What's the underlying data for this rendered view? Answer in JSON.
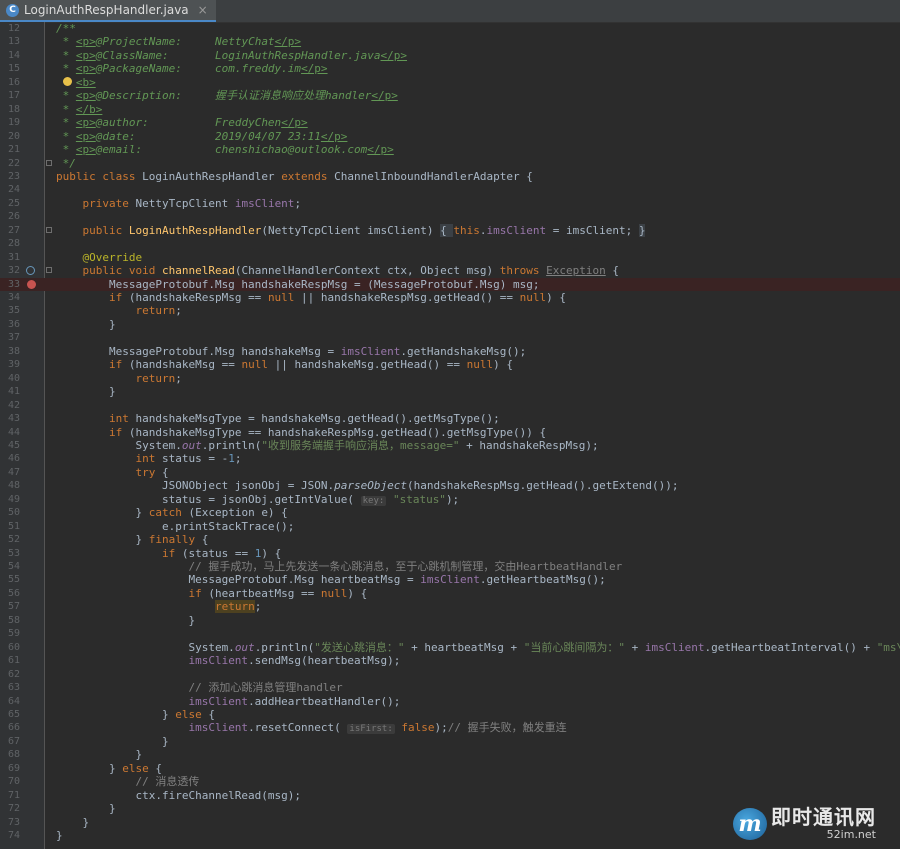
{
  "tab": {
    "filename": "LoginAuthRespHandler.java",
    "icon_letter": "C",
    "close_glyph": "×"
  },
  "lines": [
    {
      "n": "12",
      "html": "<span class=\"cm\">/**</span>"
    },
    {
      "n": "13",
      "html": "<span class=\"cm\"> * <span class=\"tg\">&lt;p&gt;</span>@ProjectName:     NettyChat<span class=\"tg\">&lt;/p&gt;</span></span>"
    },
    {
      "n": "14",
      "html": "<span class=\"cm\"> * <span class=\"tg\">&lt;p&gt;</span>@ClassName:       LoginAuthRespHandler.java<span class=\"tg\">&lt;/p&gt;</span></span>"
    },
    {
      "n": "15",
      "html": "<span class=\"cm\"> * <span class=\"tg\">&lt;p&gt;</span>@PackageName:     com.freddy.im<span class=\"tg\">&lt;/p&gt;</span></span>"
    },
    {
      "n": "16",
      "html": "<span class=\"cm\">   <span class=\"tg\">&lt;b&gt;</span></span>",
      "bulb": true
    },
    {
      "n": "17",
      "html": "<span class=\"cm\"> * <span class=\"tg\">&lt;p&gt;</span>@Description:     握手认证消息响应处理handler<span class=\"tg\">&lt;/p&gt;</span></span>"
    },
    {
      "n": "18",
      "html": "<span class=\"cm\"> * <span class=\"tg\">&lt;/b&gt;</span></span>"
    },
    {
      "n": "19",
      "html": "<span class=\"cm\"> * <span class=\"tg\">&lt;p&gt;</span>@author:          FreddyChen<span class=\"tg\">&lt;/p&gt;</span></span>"
    },
    {
      "n": "20",
      "html": "<span class=\"cm\"> * <span class=\"tg\">&lt;p&gt;</span>@date:            2019/04/07 23:11<span class=\"tg\">&lt;/p&gt;</span></span>"
    },
    {
      "n": "21",
      "html": "<span class=\"cm\"> * <span class=\"tg\">&lt;p&gt;</span>@email:           chenshichao@outlook.com<span class=\"tg\">&lt;/p&gt;</span></span>"
    },
    {
      "n": "22",
      "html": "<span class=\"cm\"> */</span>",
      "fold": true
    },
    {
      "n": "23",
      "html": "<span class=\"kw\">public class</span> LoginAuthRespHandler <span class=\"kw\">extends</span> ChannelInboundHandlerAdapter {"
    },
    {
      "n": "24",
      "html": ""
    },
    {
      "n": "25",
      "html": "    <span class=\"kw\">private</span> NettyTcpClient <span class=\"fld\">imsClient</span>;"
    },
    {
      "n": "26",
      "html": ""
    },
    {
      "n": "27",
      "html": "    <span class=\"kw\">public</span> <span class=\"fn\">LoginAuthRespHandler</span>(NettyTcpClient imsClient) <span class=\"fold-box\">{ </span><span class=\"kw\">this</span>.<span class=\"fld\">imsClient</span> = imsClient; <span class=\"fold-box\">}</span>",
      "fold": true
    },
    {
      "n": "28",
      "html": ""
    },
    {
      "n": "31",
      "html": "    <span class=\"an\">@Override</span>"
    },
    {
      "n": "32",
      "html": "    <span class=\"kw\">public void</span> <span class=\"fn\">channelRead</span>(ChannelHandlerContext ctx, Object msg) <span class=\"kw\">throws</span> <span class=\"lc\" style=\"text-decoration:underline\">Exception</span> {",
      "ovr": true,
      "fold": true
    },
    {
      "n": "33",
      "html": "        MessageProtobuf.Msg handshakeRespMsg = (MessageProtobuf.Msg) msg;",
      "bp": true
    },
    {
      "n": "34",
      "html": "        <span class=\"kw\">if</span> (handshakeRespMsg == <span class=\"kw\">null</span> || handshakeRespMsg.getHead() == <span class=\"kw\">null</span>) {"
    },
    {
      "n": "35",
      "html": "            <span class=\"kw\">return</span>;"
    },
    {
      "n": "36",
      "html": "        }"
    },
    {
      "n": "37",
      "html": ""
    },
    {
      "n": "38",
      "html": "        MessageProtobuf.Msg handshakeMsg = <span class=\"fld\">imsClient</span>.getHandshakeMsg();"
    },
    {
      "n": "39",
      "html": "        <span class=\"kw\">if</span> (handshakeMsg == <span class=\"kw\">null</span> || handshakeMsg.getHead() == <span class=\"kw\">null</span>) {"
    },
    {
      "n": "40",
      "html": "            <span class=\"kw\">return</span>;"
    },
    {
      "n": "41",
      "html": "        }"
    },
    {
      "n": "42",
      "html": ""
    },
    {
      "n": "43",
      "html": "        <span class=\"kw\">int</span> handshakeMsgType = handshakeMsg.getHead().getMsgType();"
    },
    {
      "n": "44",
      "html": "        <span class=\"kw\">if</span> (handshakeMsgType == handshakeRespMsg.getHead().getMsgType()) {"
    },
    {
      "n": "45",
      "html": "            System.<span class=\"fld it\">out</span>.println(<span class=\"st\">\"收到服务端握手响应消息，message=\"</span> + handshakeRespMsg);"
    },
    {
      "n": "46",
      "html": "            <span class=\"kw\">int</span> status = -<span style=\"color:#6897bb\">1</span>;"
    },
    {
      "n": "47",
      "html": "            <span class=\"kw\">try</span> {"
    },
    {
      "n": "48",
      "html": "                JSONObject jsonObj = JSON.<span class=\"it\">parseObject</span>(handshakeRespMsg.getHead().getExtend());"
    },
    {
      "n": "49",
      "html": "                status = jsonObj.getIntValue( <span class=\"hint\">key:</span> <span class=\"st\">\"status\"</span>);"
    },
    {
      "n": "50",
      "html": "            } <span class=\"kw\">catch</span> (Exception e) {"
    },
    {
      "n": "51",
      "html": "                e.printStackTrace();"
    },
    {
      "n": "52",
      "html": "            } <span class=\"kw\">finally</span> {"
    },
    {
      "n": "53",
      "html": "                <span class=\"kw\">if</span> (status == <span style=\"color:#6897bb\">1</span>) {"
    },
    {
      "n": "54",
      "html": "                    <span class=\"lc\">// 握手成功，马上先发送一条心跳消息，至于心跳机制管理，交由HeartbeatHandler</span>"
    },
    {
      "n": "55",
      "html": "                    MessageProtobuf.Msg heartbeatMsg = <span class=\"fld\">imsClient</span>.getHeartbeatMsg();"
    },
    {
      "n": "56",
      "html": "                    <span class=\"kw\">if</span> (heartbeatMsg == <span class=\"kw\">null</span>) {"
    },
    {
      "n": "57",
      "html": "                        <span class=\"kw ret\">return</span>;"
    },
    {
      "n": "58",
      "html": "                    }"
    },
    {
      "n": "59",
      "html": ""
    },
    {
      "n": "60",
      "html": "                    System.<span class=\"fld it\">out</span>.println(<span class=\"st\">\"发送心跳消息：\"</span> + heartbeatMsg + <span class=\"st\">\"当前心跳间隔为：\"</span> + <span class=\"fld\">imsClient</span>.getHeartbeatInterval() + <span class=\"st\">\"ms\\n\"</span>);"
    },
    {
      "n": "61",
      "html": "                    <span class=\"fld\">imsClient</span>.sendMsg(heartbeatMsg);"
    },
    {
      "n": "62",
      "html": ""
    },
    {
      "n": "63",
      "html": "                    <span class=\"lc\">// 添加心跳消息管理handler</span>"
    },
    {
      "n": "64",
      "html": "                    <span class=\"fld\">imsClient</span>.addHeartbeatHandler();"
    },
    {
      "n": "65",
      "html": "                } <span class=\"kw\">else</span> {"
    },
    {
      "n": "66",
      "html": "                    <span class=\"fld\">imsClient</span>.resetConnect( <span class=\"hint\">isFirst:</span> <span class=\"kw\">false</span>);<span class=\"lc\">// 握手失败，触发重连</span>"
    },
    {
      "n": "67",
      "html": "                }"
    },
    {
      "n": "68",
      "html": "            }"
    },
    {
      "n": "69",
      "html": "        } <span class=\"kw\">else</span> {"
    },
    {
      "n": "70",
      "html": "            <span class=\"lc\">// 消息透传</span>"
    },
    {
      "n": "71",
      "html": "            ctx.fireChannelRead(msg);"
    },
    {
      "n": "72",
      "html": "        }"
    },
    {
      "n": "73",
      "html": "    }"
    },
    {
      "n": "74",
      "html": "}"
    }
  ],
  "watermark": {
    "logo_letter": "m",
    "cn": "即时通讯网",
    "url": "52im.net"
  },
  "colors": {
    "background": "#2b2b2b",
    "keyword": "#cc7832",
    "comment": "#629755",
    "string": "#6a8759",
    "field": "#9876aa",
    "method": "#ffc66d",
    "annotation": "#bbb529",
    "breakpoint": "#c75450"
  }
}
